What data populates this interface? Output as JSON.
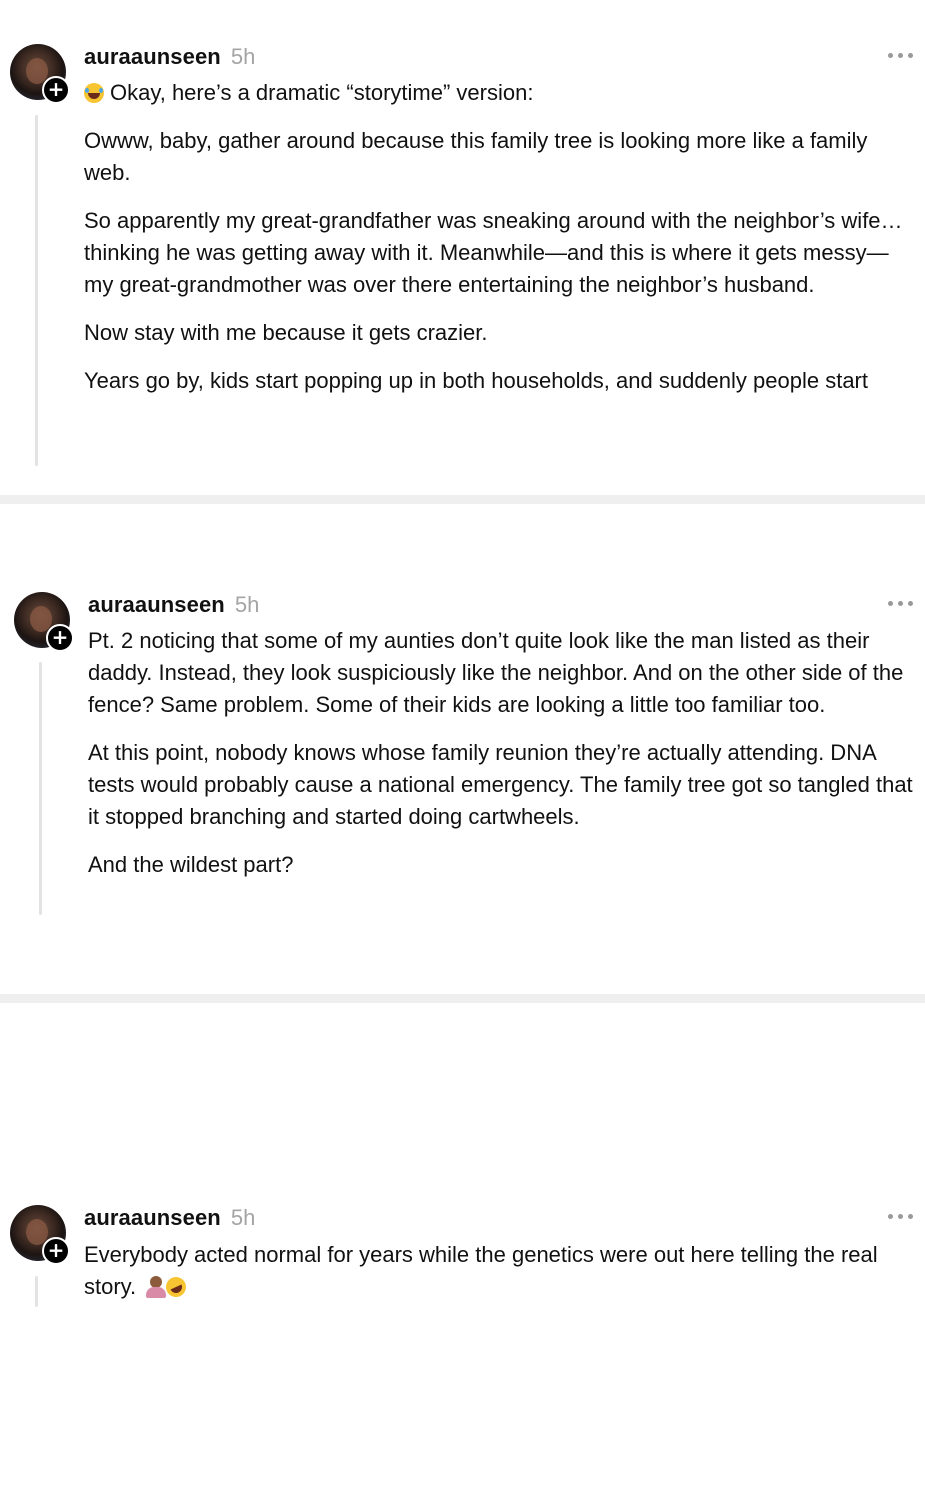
{
  "posts": [
    {
      "username": "auraaunseen",
      "time": "5h",
      "intro": "Okay, here’s a dramatic “storytime” version:",
      "paragraphs": [
        "Owww, baby, gather around because this family tree is looking more like a family web.",
        "So apparently my great-grandfather was sneaking around with the neighbor’s wife… thinking he was getting away with it. Meanwhile—and this is where it gets messy—my great-grandmother was over there entertaining the neighbor’s husband.",
        "Now stay with me because it gets crazier.",
        "Years go by, kids start popping up in both households, and suddenly people start"
      ]
    },
    {
      "username": "auraaunseen",
      "time": "5h",
      "paragraphs": [
        "Pt. 2 noticing that some of my aunties don’t quite look like the man listed as their daddy. Instead, they look suspiciously like the neighbor. And on the other side of the fence? Same problem. Some of their kids are looking a little too familiar too.",
        "At this point, nobody knows whose family reunion they’re actually attending. DNA tests would probably cause a national emergency. The family tree got so tangled that it stopped branching and started doing cartwheels.",
        "And the wildest part?"
      ]
    },
    {
      "username": "auraaunseen",
      "time": "5h",
      "paragraphs": [
        "Everybody acted normal for years while the genetics were out here telling the real story."
      ]
    }
  ],
  "icons": {
    "intro_emoji": "face-with-tears-of-joy",
    "closing_emojis": [
      "person-facepalming",
      "rolling-on-floor-laughing"
    ],
    "follow_badge": "plus",
    "more_menu": "more-horizontal"
  },
  "colors": {
    "text": "#111111",
    "timestamp": "#a4a4a4",
    "thread_line": "#e3e3e3",
    "divider": "#efefef"
  }
}
